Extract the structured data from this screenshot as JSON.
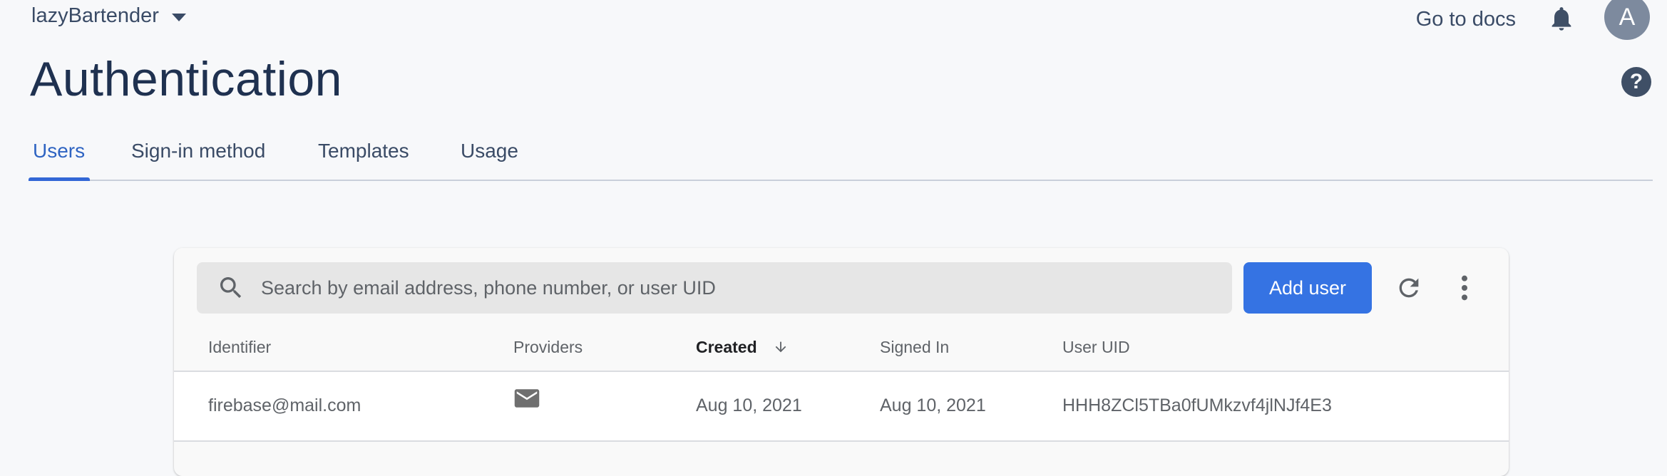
{
  "project": {
    "name": "lazyBartender"
  },
  "topbar": {
    "docs_label": "Go to docs",
    "avatar_letter": "A"
  },
  "page": {
    "title": "Authentication",
    "help_label": "?"
  },
  "tabs": [
    {
      "label": "Users",
      "active": true
    },
    {
      "label": "Sign-in method",
      "active": false
    },
    {
      "label": "Templates",
      "active": false
    },
    {
      "label": "Usage",
      "active": false
    }
  ],
  "users": {
    "search_placeholder": "Search by email address, phone number, or user UID",
    "add_user_label": "Add user",
    "columns": [
      "Identifier",
      "Providers",
      "Created",
      "Signed In",
      "User UID"
    ],
    "sort_column": "Created",
    "rows": [
      {
        "identifier": "firebase@mail.com",
        "provider_icon": "mail-icon",
        "created": "Aug 10, 2021",
        "signed_in": "Aug 10, 2021",
        "uid": "HHH8ZCl5TBa0fUMkzvf4jlNJf4E3"
      }
    ]
  },
  "colors": {
    "accent": "#3573e3",
    "active_tab": "#2f64c2",
    "title": "#1f3150",
    "background": "#f7f8fa"
  }
}
